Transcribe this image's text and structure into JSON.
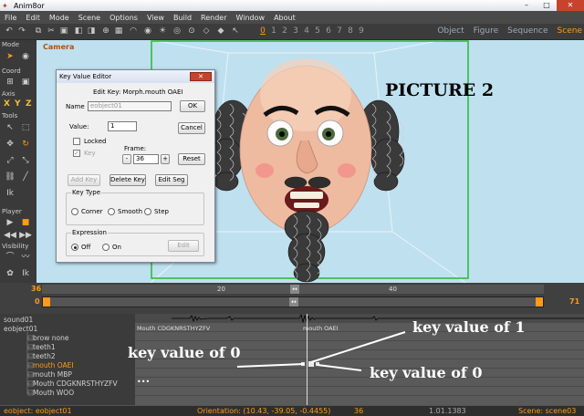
{
  "window": {
    "title": "Anim8or",
    "minimize": "–",
    "maximize": "□",
    "close": "✕"
  },
  "menu": [
    "File",
    "Edit",
    "Mode",
    "Scene",
    "Options",
    "View",
    "Build",
    "Render",
    "Window",
    "About"
  ],
  "toolbar": {
    "frames": [
      "0",
      "1",
      "2",
      "3",
      "4",
      "5",
      "6",
      "7",
      "8",
      "9"
    ],
    "active_frame": "0",
    "modes": [
      "Object",
      "Figure",
      "Sequence",
      "Scene"
    ],
    "active_mode": "Scene"
  },
  "palette": {
    "sections": [
      "Mode",
      "Coord",
      "Axis",
      "Tools",
      "Player",
      "Visibility"
    ],
    "axis": [
      "X",
      "Y",
      "Z"
    ],
    "ik_label": "Ik"
  },
  "viewport": {
    "camera_label": "Camera",
    "picture_label": "PICTURE 2"
  },
  "dialog": {
    "title": "Key Value Editor",
    "close": "✕",
    "heading": "Edit Key: Morph.mouth OAEI",
    "name_label": "Name",
    "name_value": "eobject01",
    "ok": "OK",
    "value_label": "Value:",
    "value": "1",
    "cancel": "Cancel",
    "locked": "Locked",
    "key": "Key",
    "frame_label": "Frame:",
    "frame_minus": "-",
    "frame_value": "36",
    "frame_plus": "+",
    "reset": "Reset",
    "add_key": "Add Key",
    "delete_key": "Delete Key",
    "edit_seg": "Edit Seg",
    "key_type_label": "Key Type",
    "key_types": [
      "Corner",
      "Smooth",
      "Step"
    ],
    "expression_label": "Expression",
    "expr_off": "Off",
    "expr_on": "On",
    "edit": "Edit"
  },
  "timeline": {
    "current": "36",
    "start": "0",
    "end": "71",
    "ruler_marks": [
      "20",
      "40"
    ]
  },
  "tracks": {
    "names": [
      "sound01",
      "eobject01",
      "brow none",
      "teeth1",
      "teeth2",
      "mouth OAEI",
      "mouth MBP",
      "Mouth CDGKNRSTHYZFV",
      "Mouth WOO"
    ],
    "highlighted": "mouth OAEI",
    "segment_labels": [
      "Mouth CDGKNRSTHYZFV",
      "mouth OAEI"
    ],
    "annotations": {
      "one": "key value of 1",
      "zero_left": "key value of 0",
      "zero_right": "key value of 0"
    },
    "ellipsis": "•••"
  },
  "status": {
    "object": "eobject: eobject01",
    "orientation": "Orientation: (10.43, -39.05, -0.4455)",
    "frame": "36",
    "version": "1.01.1383",
    "scene": "Scene: scene03"
  }
}
